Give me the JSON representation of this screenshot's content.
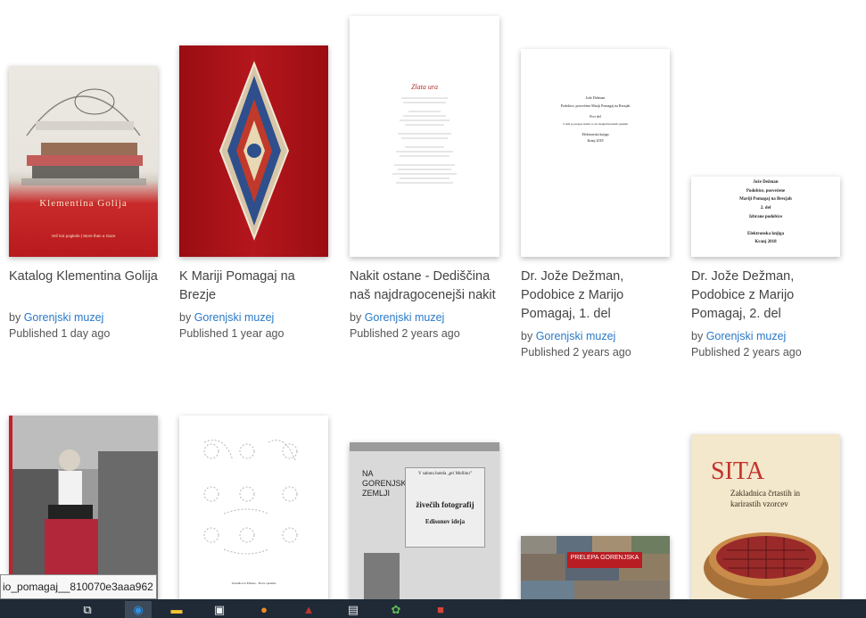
{
  "publications": [
    {
      "title": "Katalog Klementina Golija",
      "by_label": "by",
      "publisher": "Gorenjski muzej",
      "published": "Published 1 day ago",
      "cover": {
        "title": "Klementina Golija",
        "subtitle": "Več kot poglede | More than a Gaze"
      }
    },
    {
      "title": "K Mariji Pomagaj na Brezje",
      "by_label": "by",
      "publisher": "Gorenjski muzej",
      "published": "Published 1 year ago"
    },
    {
      "title": "Nakit ostane - Dediščina naš najdragocenejši nakit",
      "by_label": "by",
      "publisher": "Gorenjski muzej",
      "published": "Published 2 years ago",
      "cover": {
        "title": "Zlata ura"
      }
    },
    {
      "title": "Dr. Jože Dežman, Podobice z Marijo Pomagaj, 1. del",
      "by_label": "by",
      "publisher": "Gorenjski muzej",
      "published": "Published 2 years ago",
      "cover": {
        "lines": [
          "Jože Dežman",
          "Podobice, posvečene Mariji Pomagaj na Brezjah",
          "Prvi del",
          "S tem je pregon izašlo to do mogleh krasnih opisnik",
          "Elektronska knjiga",
          "Kranj 2018"
        ]
      }
    },
    {
      "title": "Dr. Jože Dežman, Podobice z Marijo Pomagaj, 2. del",
      "by_label": "by",
      "publisher": "Gorenjski muzej",
      "published": "Published 2 years ago",
      "cover": {
        "lines": [
          "Jože Dežman",
          "Podobice, posvečene",
          "Mariji Pomagaj na Brezjah",
          "2. del",
          "Izbrane podobice",
          "Elektronska knjiga",
          "Kranj 2018"
        ]
      }
    },
    {
      "title": "",
      "cover": {}
    },
    {
      "title": "",
      "cover": {
        "caption": "Zvezdice iz Emona - Nove opomba"
      }
    },
    {
      "title": "",
      "cover": {
        "heading": "NA GORENJSKI ZEMLJI",
        "ad": "V salonu hotela „pri Mollinu”",
        "ad2": "živečih fotografij",
        "ad3": "Edisonov ideja"
      }
    },
    {
      "title": "",
      "cover": {
        "title": "PRELEPA GORENJSKA"
      }
    },
    {
      "title": "",
      "cover": {
        "title": "SITA",
        "subtitle": "Zakladnica črtastih in karirastih vzorcev"
      }
    }
  ],
  "status_tooltip": "io_pomagaj__810070e3aaa962",
  "taskbar": {
    "icons": [
      "task-view-icon",
      "edge-icon",
      "file-explorer-icon",
      "store-icon",
      "firefox-icon",
      "app-icon",
      "office-icon",
      "photos-icon",
      "app2-icon"
    ]
  }
}
